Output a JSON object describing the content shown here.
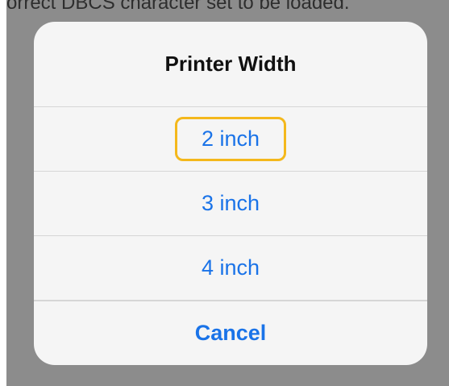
{
  "background": {
    "text": "orrect DBCS character set to be loaded."
  },
  "sheet": {
    "title": "Printer Width",
    "options": [
      {
        "label": "2 inch",
        "highlighted": true
      },
      {
        "label": "3 inch",
        "highlighted": false
      },
      {
        "label": "4 inch",
        "highlighted": false
      }
    ],
    "cancel_label": "Cancel"
  },
  "colors": {
    "action_blue": "#1a73e8",
    "highlight_ring": "#f4b81c",
    "sheet_bg": "#f5f5f5",
    "dim_overlay": "#8c8c8c"
  }
}
